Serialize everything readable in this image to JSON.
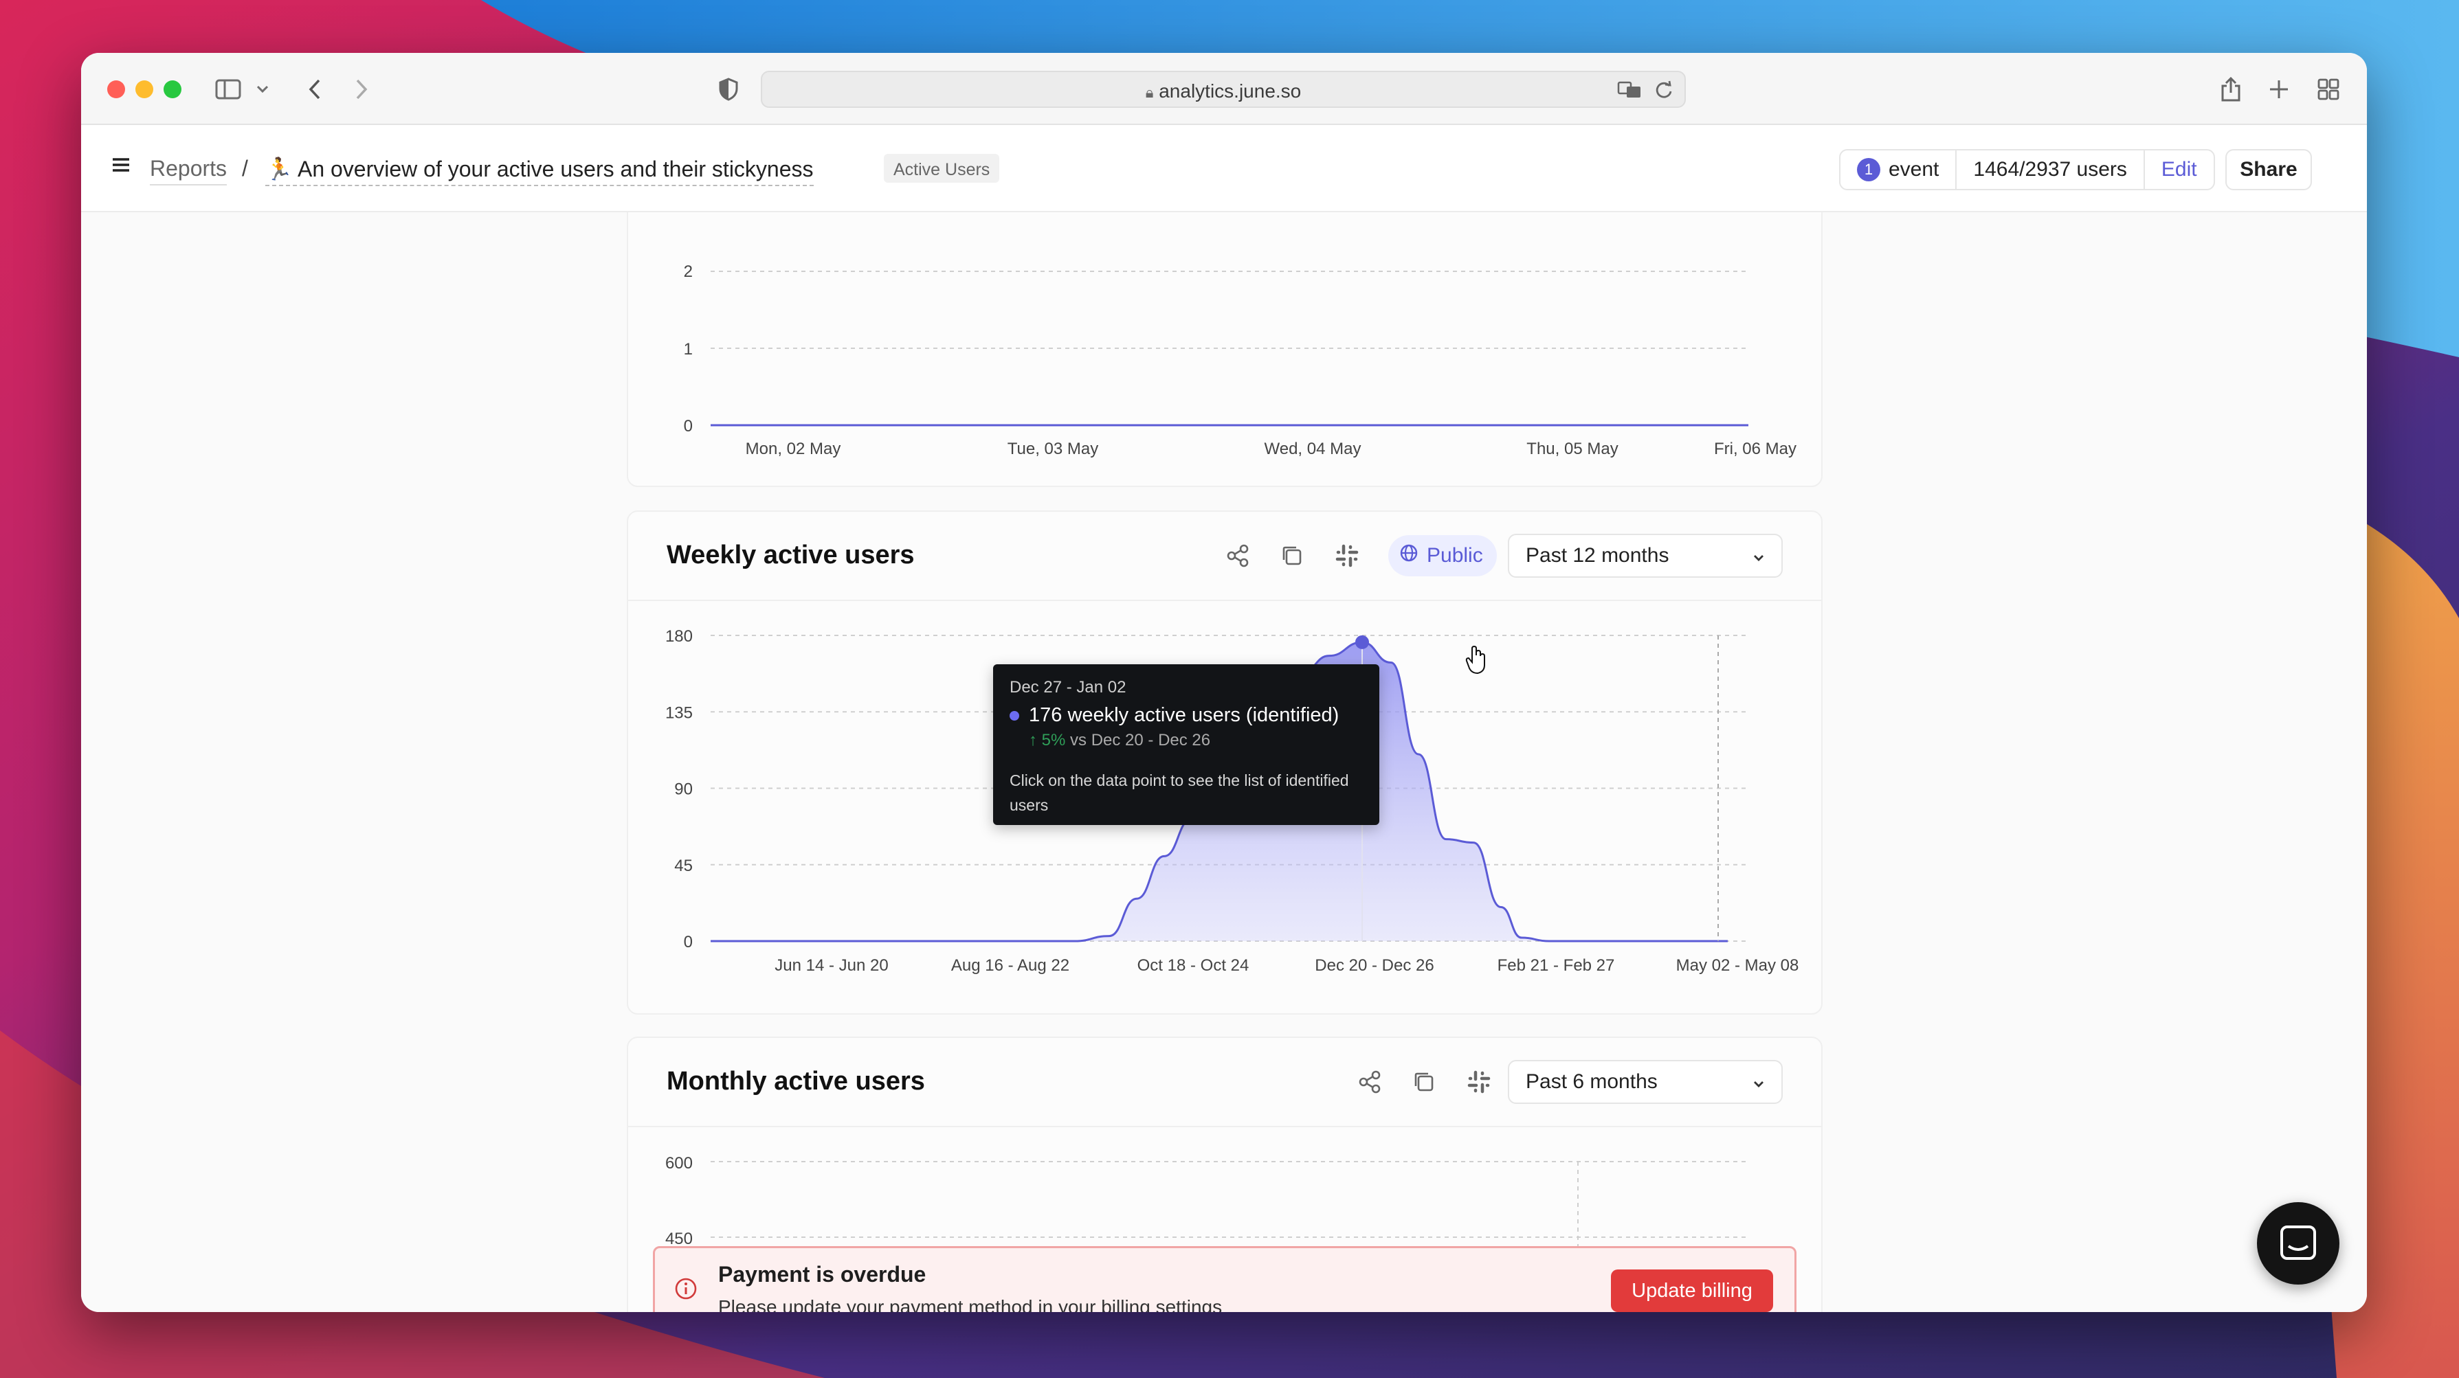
{
  "browser": {
    "url": "analytics.june.so"
  },
  "header": {
    "breadcrumb_root": "Reports",
    "separator": "/",
    "report_emoji": "🏃",
    "report_title": "An overview of your active users and their stickyness",
    "tag": "Active Users",
    "event_count": "1",
    "event_label": "event",
    "users": "1464/2937 users",
    "edit_label": "Edit",
    "share_label": "Share"
  },
  "daily_chart_fragment": {
    "y_ticks_visible": [
      "1",
      "0"
    ],
    "x_ticks": [
      "Mon, 02 May",
      "Tue, 03 May",
      "Wed, 04 May",
      "Thu, 05 May",
      "Fri, 06 May"
    ]
  },
  "weekly_card": {
    "title": "Weekly active users",
    "public_label": "Public",
    "range": "Past 12 months",
    "icons": [
      "share-icon",
      "copy-icon",
      "slack-icon",
      "globe-icon",
      "chevron-down-icon"
    ]
  },
  "monthly_card": {
    "title": "Monthly active users",
    "range": "Past 6 months",
    "y_ticks_visible": [
      "600",
      "450"
    ]
  },
  "tooltip": {
    "date": "Dec 27 - Jan 02",
    "value_line": "176 weekly active users (identified)",
    "change": "5%",
    "compare": "vs Dec 20 - Dec 26",
    "hint": "Click on the data point to see the list of identified users"
  },
  "payment": {
    "title": "Payment is overdue",
    "message": "Please update your payment method in your billing settings",
    "button": "Update billing"
  },
  "colors": {
    "accent": "#5b5bd6",
    "danger": "#e23b3b",
    "success": "#2f9e58"
  },
  "chart_data": [
    {
      "type": "area",
      "title": "Weekly active users",
      "x_tick_labels": [
        "Jun 14 - Jun 20",
        "Aug 16 - Aug 22",
        "Oct 18 - Oct 24",
        "Dec 20 - Dec 26",
        "Feb 21 - Feb 27",
        "May 02 - May 08"
      ],
      "y_ticks": [
        0,
        45,
        90,
        135,
        180
      ],
      "ylim": [
        0,
        180
      ],
      "grid": true,
      "highlight": {
        "x": "Dec 27 - Jan 02",
        "y": 176
      },
      "series": [
        {
          "x": [
            "May 10 - May 16",
            "Jun 14 - Jun 20",
            "Aug 16 - Aug 22",
            "Oct 18 - Oct 24",
            "Oct 25 - Oct 31",
            "Nov 01 - Nov 07",
            "Nov 08 - Nov 14",
            "Nov 15 - Nov 21",
            "Nov 22 - Nov 28",
            "Nov 29 - Dec 05",
            "Dec 06 - Dec 12",
            "Dec 13 - Dec 19",
            "Dec 20 - Dec 26",
            "Dec 27 - Jan 02",
            "Jan 03 - Jan 09",
            "Jan 10 - Jan 16",
            "Jan 17 - Jan 23",
            "Jan 24 - Jan 30",
            "Jan 31 - Feb 06",
            "Feb 07 - Feb 13",
            "Feb 14 - Feb 20",
            "Feb 21 - Feb 27",
            "May 02 - May 08"
          ],
          "values": [
            0,
            0,
            0,
            0,
            3,
            25,
            50,
            72,
            92,
            115,
            140,
            158,
            168,
            176,
            164,
            110,
            60,
            58,
            20,
            2,
            0,
            0,
            0
          ]
        }
      ]
    },
    {
      "type": "line",
      "title": "",
      "x_tick_labels": [
        "Mon, 02 May",
        "Tue, 03 May",
        "Wed, 04 May",
        "Thu, 05 May",
        "Fri, 06 May"
      ],
      "y_ticks": [
        0,
        1
      ],
      "series": [
        {
          "x": [
            "Mon, 02 May",
            "Tue, 03 May",
            "Wed, 04 May",
            "Thu, 05 May",
            "Fri, 06 May"
          ],
          "values": [
            0,
            0,
            0,
            0,
            0
          ]
        }
      ]
    }
  ]
}
